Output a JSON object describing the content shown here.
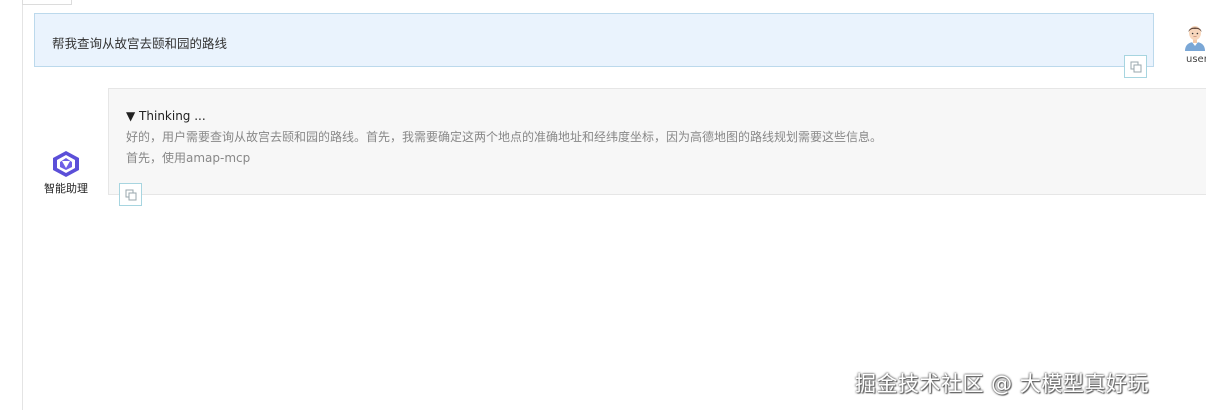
{
  "conversation": {
    "user_message": {
      "text": "帮我查询从故宫去颐和园的路线",
      "author_label": "user",
      "avatar_icon": "user-avatar-icon"
    },
    "assistant_message": {
      "author_label": "智能助理",
      "avatar_icon": "assistant-logo-icon",
      "thinking_toggle": "▼ Thinking ...",
      "thinking_lines": [
        "好的，用户需要查询从故宫去颐和园的路线。首先，我需要确定这两个地点的准确地址和经纬度坐标，因为高德地图的路线规划需要这些信息。",
        "首先，使用amap-mcp"
      ]
    },
    "copy_icon": "copy-icon"
  },
  "watermark": "掘金技术社区 @ 大模型真好玩",
  "colors": {
    "user_bubble_bg": "#eaf3fd",
    "user_bubble_border": "#bcd9ec",
    "assistant_bubble_bg": "#f7f7f7",
    "copy_button_border": "#a7d5e0",
    "thinking_text": "#888888"
  }
}
